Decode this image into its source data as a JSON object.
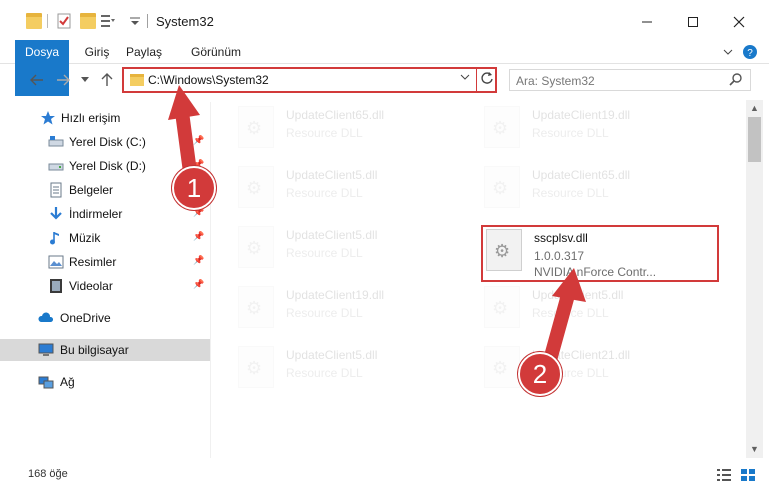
{
  "window": {
    "title": "System32",
    "minimize_icon": "minimize-icon",
    "maximize_icon": "maximize-icon",
    "close_icon": "close-icon"
  },
  "ribbon": {
    "tabs": [
      {
        "label": "Dosya"
      },
      {
        "label": "Giriş"
      },
      {
        "label": "Paylaş"
      },
      {
        "label": "Görünüm"
      }
    ]
  },
  "address": {
    "path": "C:\\Windows\\System32"
  },
  "search": {
    "placeholder": "Ara: System32"
  },
  "nav": {
    "items": [
      {
        "label": "Hızlı erişim"
      },
      {
        "label": "Yerel Disk (C:)"
      },
      {
        "label": "Yerel Disk (D:)"
      },
      {
        "label": "Belgeler"
      },
      {
        "label": "İndirmeler"
      },
      {
        "label": "Müzik"
      },
      {
        "label": "Resimler"
      },
      {
        "label": "Videolar"
      },
      {
        "label": "OneDrive"
      },
      {
        "label": "Bu bilgisayar"
      },
      {
        "label": "Ağ"
      }
    ]
  },
  "files": {
    "faded": [
      {
        "name": "UpdateClient65.dll",
        "type": "Resource DLL"
      },
      {
        "name": "UpdateClient19.dll",
        "type": "Resource DLL"
      },
      {
        "name": "UpdateClient5.dll",
        "type": "Resource DLL"
      },
      {
        "name": "UpdateClient65.dll",
        "type": "Resource DLL"
      },
      {
        "name": "UpdateClient5.dll",
        "type": "Resource DLL"
      },
      {
        "name": "UpdateClient19.dll",
        "type": "Resource DLL"
      },
      {
        "name": "UpdateClient5.dll",
        "type": "Resource DLL"
      },
      {
        "name": "UpdateClient5.dll",
        "type": "Resource DLL"
      },
      {
        "name": "UpdateClient21.dll",
        "type": "Resource DLL"
      }
    ],
    "highlighted": {
      "name": "sscplsv.dll",
      "version": "1.0.0.317",
      "description": "NVIDIA nForce Contr..."
    }
  },
  "status": {
    "count": "168 öğe"
  },
  "annotations": {
    "step1": "1",
    "step2": "2",
    "color": "#d23a3a"
  }
}
